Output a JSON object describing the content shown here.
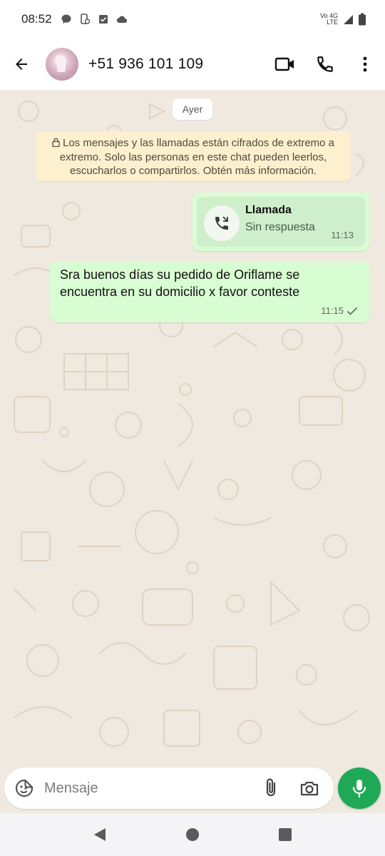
{
  "status_bar": {
    "time": "08:52",
    "network_top": "Vo 4G",
    "network_bottom": "LTE",
    "icons": [
      "chat-bubble-icon",
      "phone-settings-icon",
      "checkbox-icon",
      "cloud-icon",
      "signal-icon",
      "battery-icon"
    ]
  },
  "header": {
    "contact": "+51 936 101 109",
    "icons": [
      "back-arrow-icon",
      "video-call-icon",
      "voice-call-icon",
      "more-vert-icon"
    ]
  },
  "chat": {
    "date_label": "Ayer",
    "encryption_notice": "Los mensajes y las llamadas están cifrados de extremo a extremo. Solo las personas en este chat pueden leerlos, escucharlos o compartirlos. Obtén más información.",
    "messages": [
      {
        "type": "call",
        "title": "Llamada",
        "subtitle": "Sin respuesta",
        "time": "11:13"
      },
      {
        "type": "text",
        "text": "Sra buenos días su pedido de Oriflame se encuentra en su domicilio x favor conteste",
        "time": "11:15",
        "status": "sent-check"
      }
    ]
  },
  "composer": {
    "placeholder": "Mensaje",
    "icons": [
      "sticker-icon",
      "paperclip-icon",
      "camera-icon",
      "mic-icon"
    ]
  },
  "nav_bar": {
    "icons": [
      "back-triangle-icon",
      "home-circle-icon",
      "recents-square-icon"
    ]
  },
  "colors": {
    "bubble_out": "#d9fdd3",
    "notice_bg": "#fcf0cf",
    "accent_green": "#1fa855",
    "chat_bg": "#efe9df"
  }
}
